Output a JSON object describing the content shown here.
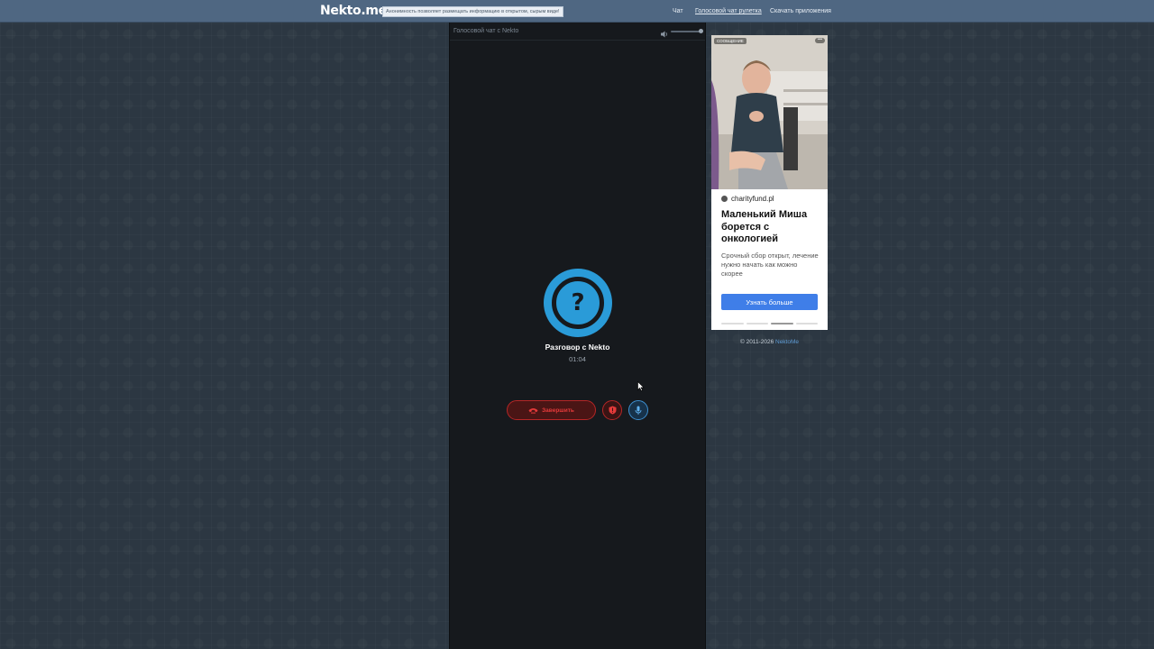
{
  "header": {
    "logo": "Nekto.me",
    "notice": "Анонимность позволяет размещать информацию в открытом, сырым виде!",
    "nav": {
      "chat": "Чат",
      "voice_chat": "Голосовой чат рулетка",
      "download_apps": "Скачать приложения"
    }
  },
  "chat": {
    "title": "Голосовой чат с Nekto",
    "volume_icon": "speaker-icon",
    "volume_level": 1.0,
    "peer_avatar": "?",
    "peer_name": "Разговор с Nekto",
    "timer": "01:04",
    "end_button": "Завершить",
    "report_icon": "shield-icon",
    "mic_icon": "microphone-icon"
  },
  "ad": {
    "badge": "СООБЩЕНИЕ",
    "more": "•••",
    "source": "charityfund.pl",
    "title": "Маленький Миша борется с онкологией",
    "text": "Срочный сбор открыт, лечение нужно начать как можно скорее",
    "cta": "Узнать больше"
  },
  "footer": {
    "copyright": "© 2011-2026",
    "link": "NektoMe"
  },
  "colors": {
    "accent_blue": "#2a9bd8",
    "danger_red": "#e53a3a",
    "topbar": "#4f6782",
    "cta_blue": "#3f7ee8"
  }
}
